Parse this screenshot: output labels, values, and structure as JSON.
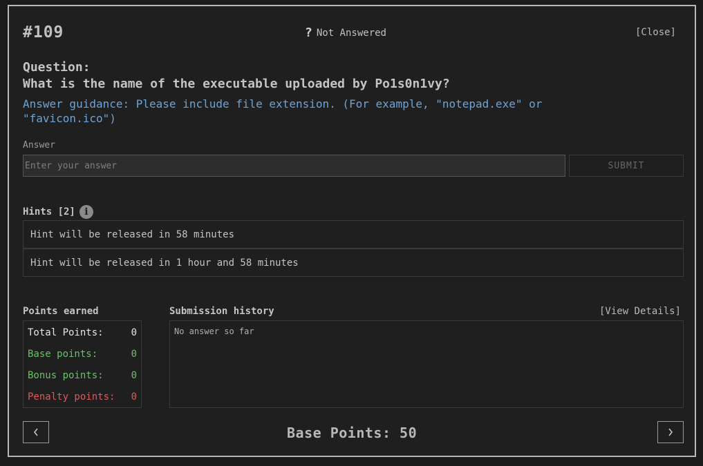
{
  "question": {
    "number": "#109",
    "status_icon": "?",
    "status_text": "Not Answered",
    "close_label": "[Close]",
    "label": "Question:",
    "text": "What is the name of the executable uploaded by Po1s0n1vy?",
    "guidance": "Answer guidance: Please include file extension. (For example, \"notepad.exe\" or \"favicon.ico\")"
  },
  "answer": {
    "label": "Answer",
    "placeholder": "Enter your answer",
    "value": "",
    "submit_label": "SUBMIT"
  },
  "hints": {
    "label": "Hints [2]",
    "info_icon": "i",
    "items": [
      "Hint will be released in 58 minutes",
      "Hint will be released in 1 hour and 58 minutes"
    ]
  },
  "points": {
    "label": "Points earned",
    "total_label": "Total Points:",
    "total_value": "0",
    "base_label": "Base points:",
    "base_value": "0",
    "bonus_label": "Bonus points:",
    "bonus_value": "0",
    "penalty_label": "Penalty points:",
    "penalty_value": "0"
  },
  "submission": {
    "label": "Submission history",
    "view_details": "[View Details]",
    "empty_text": "No answer so far"
  },
  "footer": {
    "base_points": "Base Points: 50"
  },
  "colors": {
    "guidance": "#6fa3d6",
    "positive": "#6cc06c",
    "penalty": "#e05a5a",
    "border": "#b8b8b8"
  }
}
